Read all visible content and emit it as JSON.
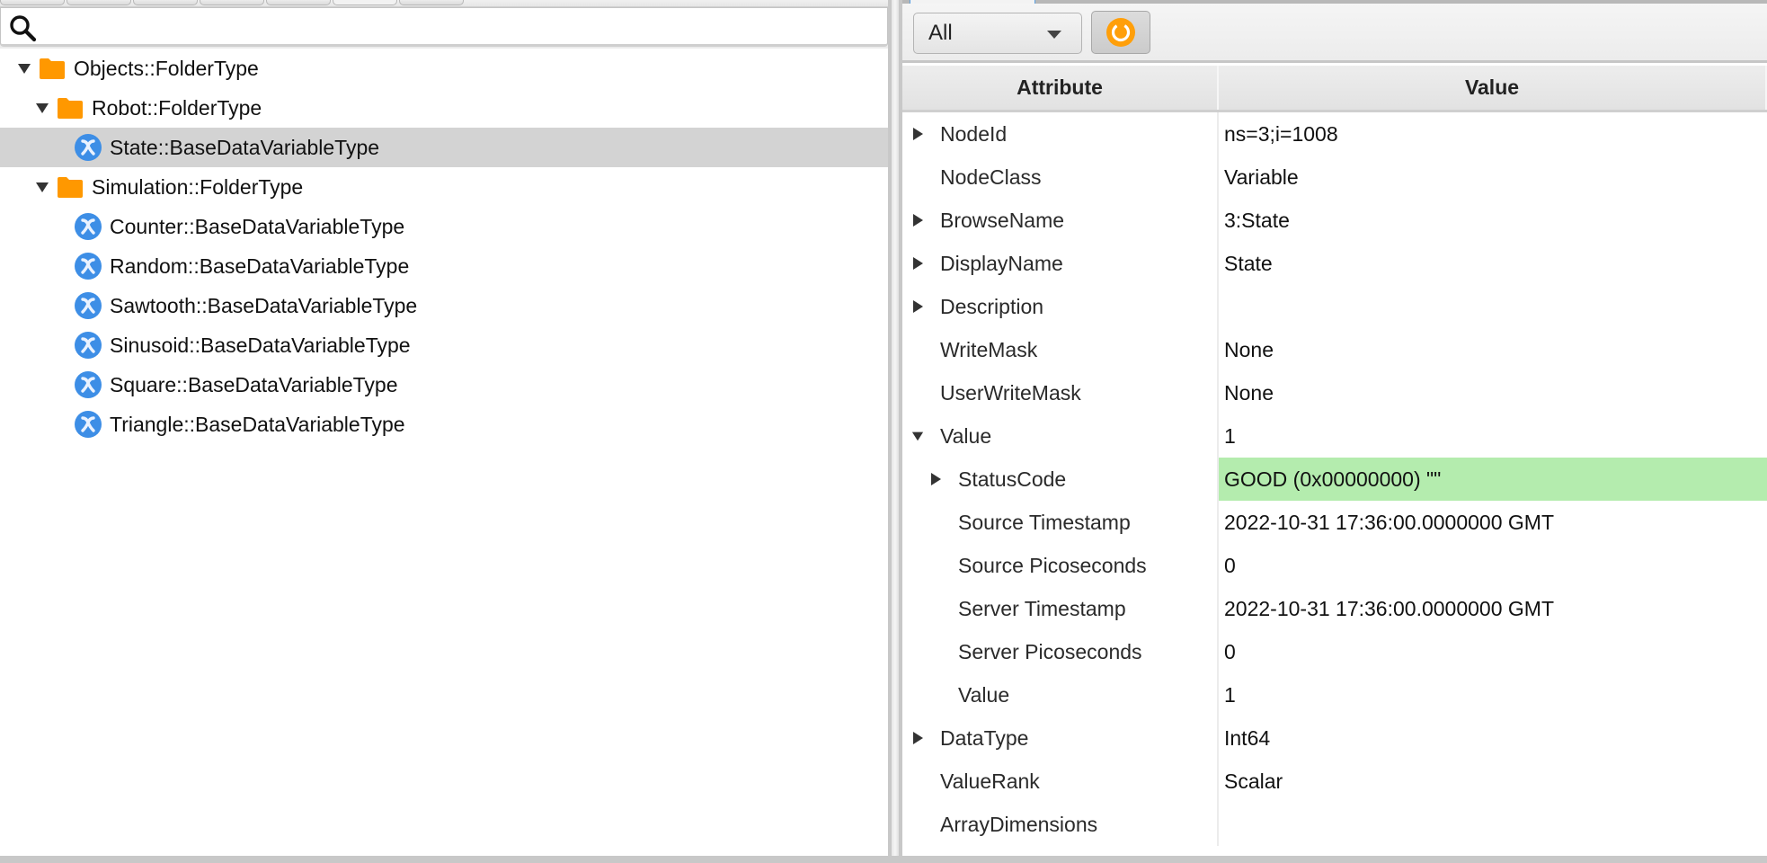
{
  "left_panel": {
    "tabs": [
      {
        "label": "",
        "selected": false
      },
      {
        "label": "",
        "selected": false
      },
      {
        "label": "",
        "selected": false
      },
      {
        "label": "",
        "selected": false
      },
      {
        "label": "",
        "selected": false
      },
      {
        "label": "",
        "selected": true
      },
      {
        "label": "",
        "selected": false
      }
    ],
    "search": {
      "value": "",
      "placeholder": "",
      "icon": "search-icon"
    },
    "tree": [
      {
        "label": "Objects::FolderType",
        "depth": 0,
        "type": "folder",
        "expanded": true,
        "selected": false
      },
      {
        "label": "Robot::FolderType",
        "depth": 1,
        "type": "folder",
        "expanded": true,
        "selected": false
      },
      {
        "label": "State::BaseDataVariableType",
        "depth": 2,
        "type": "variable",
        "expanded": null,
        "selected": true
      },
      {
        "label": "Simulation::FolderType",
        "depth": 1,
        "type": "folder",
        "expanded": true,
        "selected": false
      },
      {
        "label": "Counter::BaseDataVariableType",
        "depth": 2,
        "type": "variable",
        "expanded": null,
        "selected": false
      },
      {
        "label": "Random::BaseDataVariableType",
        "depth": 2,
        "type": "variable",
        "expanded": null,
        "selected": false
      },
      {
        "label": "Sawtooth::BaseDataVariableType",
        "depth": 2,
        "type": "variable",
        "expanded": null,
        "selected": false
      },
      {
        "label": "Sinusoid::BaseDataVariableType",
        "depth": 2,
        "type": "variable",
        "expanded": null,
        "selected": false
      },
      {
        "label": "Square::BaseDataVariableType",
        "depth": 2,
        "type": "variable",
        "expanded": null,
        "selected": false
      },
      {
        "label": "Triangle::BaseDataVariableType",
        "depth": 2,
        "type": "variable",
        "expanded": null,
        "selected": false
      }
    ]
  },
  "right_panel": {
    "toolbar": {
      "filter_value": "All",
      "refresh_icon": "refresh-icon"
    },
    "table": {
      "headers": {
        "attribute": "Attribute",
        "value": "Value"
      },
      "rows": [
        {
          "attribute": "NodeId",
          "value": "ns=3;i=1008",
          "depth": 0,
          "toggle": "collapsed",
          "status": ""
        },
        {
          "attribute": "NodeClass",
          "value": "Variable",
          "depth": 0,
          "toggle": "none",
          "status": ""
        },
        {
          "attribute": "BrowseName",
          "value": "3:State",
          "depth": 0,
          "toggle": "collapsed",
          "status": ""
        },
        {
          "attribute": "DisplayName",
          "value": "State",
          "depth": 0,
          "toggle": "collapsed",
          "status": ""
        },
        {
          "attribute": "Description",
          "value": "",
          "depth": 0,
          "toggle": "collapsed",
          "status": ""
        },
        {
          "attribute": "WriteMask",
          "value": "None",
          "depth": 0,
          "toggle": "none",
          "status": ""
        },
        {
          "attribute": "UserWriteMask",
          "value": "None",
          "depth": 0,
          "toggle": "none",
          "status": ""
        },
        {
          "attribute": "Value",
          "value": "1",
          "depth": 0,
          "toggle": "expanded",
          "status": ""
        },
        {
          "attribute": "StatusCode",
          "value": "GOOD (0x00000000) \"\"",
          "depth": 1,
          "toggle": "collapsed",
          "status": "good"
        },
        {
          "attribute": "Source Timestamp",
          "value": "2022-10-31 17:36:00.0000000 GMT",
          "depth": 1,
          "toggle": "none",
          "status": ""
        },
        {
          "attribute": "Source Picoseconds",
          "value": "0",
          "depth": 1,
          "toggle": "none",
          "status": ""
        },
        {
          "attribute": "Server Timestamp",
          "value": "2022-10-31 17:36:00.0000000 GMT",
          "depth": 1,
          "toggle": "none",
          "status": ""
        },
        {
          "attribute": "Server Picoseconds",
          "value": "0",
          "depth": 1,
          "toggle": "none",
          "status": ""
        },
        {
          "attribute": "Value",
          "value": "1",
          "depth": 1,
          "toggle": "none",
          "status": ""
        },
        {
          "attribute": "DataType",
          "value": "Int64",
          "depth": 0,
          "toggle": "collapsed",
          "status": ""
        },
        {
          "attribute": "ValueRank",
          "value": "Scalar",
          "depth": 0,
          "toggle": "none",
          "status": ""
        },
        {
          "attribute": "ArrayDimensions",
          "value": "",
          "depth": 0,
          "toggle": "none",
          "status": ""
        }
      ]
    }
  },
  "colors": {
    "folder": "#ff9800",
    "variable_icon": "#3d8ee6",
    "selection": "#d3d3d3",
    "status_good": "#b4ecae",
    "refresh_accent": "#ff9f0a"
  }
}
